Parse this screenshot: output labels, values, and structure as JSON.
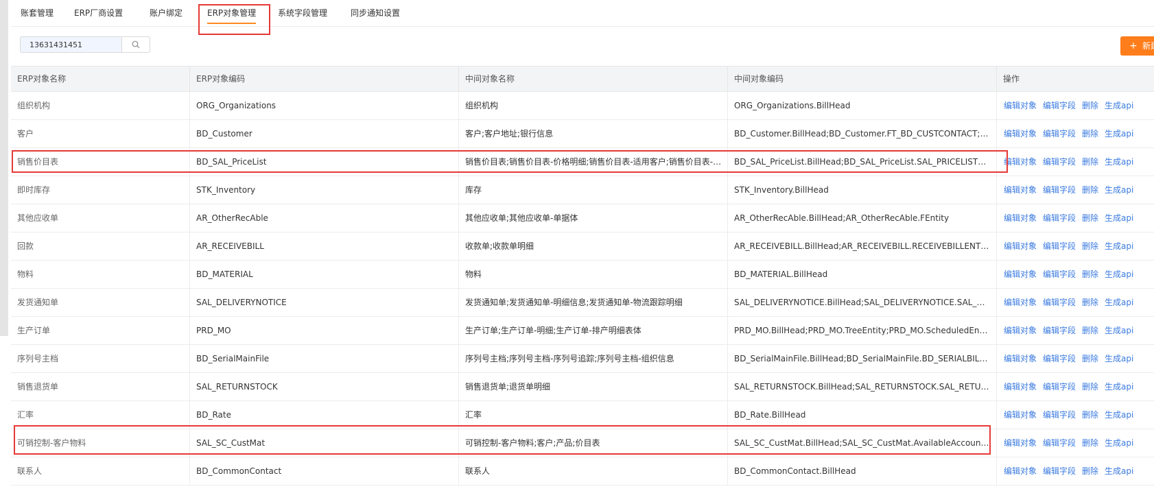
{
  "tabs": [
    {
      "label": "账套管理",
      "active": false
    },
    {
      "label": "ERP厂商设置",
      "active": false
    },
    {
      "label": "账户绑定",
      "active": false
    },
    {
      "label": "ERP对象管理",
      "active": true
    },
    {
      "label": "系统字段管理",
      "active": false
    },
    {
      "label": "同步通知设置",
      "active": false
    }
  ],
  "search": {
    "value": "13631431451",
    "placeholder": ""
  },
  "toolbar": {
    "add_label": "新建",
    "add_icon": "plus-icon"
  },
  "table": {
    "headers": [
      "ERP对象名称",
      "ERP对象编码",
      "中间对象名称",
      "中间对象编码",
      "操作"
    ],
    "actions": [
      "编辑对象",
      "编辑字段",
      "删除",
      "生成api"
    ],
    "rows": [
      [
        "组织机构",
        "ORG_Organizations",
        "组织机构",
        "ORG_Organizations.BillHead"
      ],
      [
        "客户",
        "BD_Customer",
        "客户;客户地址;银行信息",
        "BD_Customer.BillHead;BD_Customer.FT_BD_CUSTCONTACT;BD_Customer.FT_BD_CUSTBANK"
      ],
      [
        "销售价目表",
        "BD_SAL_PriceList",
        "销售价目表;销售价目表-价格明细;销售价目表-适用客户;销售价目表-适用销售员",
        "BD_SAL_PriceList.BillHead;BD_SAL_PriceList.SAL_PRICELISTENTRY;BD_SAL_PriceList.SAL_APPLYCUSTOMER"
      ],
      [
        "即时库存",
        "STK_Inventory",
        "库存",
        "STK_Inventory.BillHead"
      ],
      [
        "其他应收单",
        "AR_OtherRecAble",
        "其他应收单;其他应收单-单据体",
        "AR_OtherRecAble.BillHead;AR_OtherRecAble.FEntity"
      ],
      [
        "回款",
        "AR_RECEIVEBILL",
        "收款单;收款单明细",
        "AR_RECEIVEBILL.BillHead;AR_RECEIVEBILL.RECEIVEBILLENTRY"
      ],
      [
        "物料",
        "BD_MATERIAL",
        "物料",
        "BD_MATERIAL.BillHead"
      ],
      [
        "发货通知单",
        "SAL_DELIVERYNOTICE",
        "发货通知单;发货通知单-明细信息;发货通知单-物流跟踪明细",
        "SAL_DELIVERYNOTICE.BillHead;SAL_DELIVERYNOTICE.SAL_DELIVERYNOTICEENTRY"
      ],
      [
        "生产订单",
        "PRD_MO",
        "生产订单;生产订单-明细;生产订单-排产明细表体",
        "PRD_MO.BillHead;PRD_MO.TreeEntity;PRD_MO.ScheduledEntity"
      ],
      [
        "序列号主档",
        "BD_SerialMainFile",
        "序列号主档;序列号主档-序列号追踪;序列号主档-组织信息",
        "BD_SerialMainFile.BillHead;BD_SerialMainFile.BD_SERIALBILLTRACE;BD_SerialMainFile.BD_SERIALORG"
      ],
      [
        "销售退货单",
        "SAL_RETURNSTOCK",
        "销售退货单;退货单明细",
        "SAL_RETURNSTOCK.BillHead;SAL_RETURNSTOCK.SAL_RETURNSTOCKENTRY"
      ],
      [
        "汇率",
        "BD_Rate",
        "汇率",
        "BD_Rate.BillHead"
      ],
      [
        "可销控制-客户物料",
        "SAL_SC_CustMat",
        "可销控制-客户物料;客户;产品;价目表",
        "SAL_SC_CustMat.BillHead;SAL_SC_CustMat.AvailableAccountObj;SAL_SC_CustMat.Product"
      ],
      [
        "联系人",
        "BD_CommonContact",
        "联系人",
        "BD_CommonContact.BillHead"
      ]
    ]
  },
  "colors": {
    "accent": "#ff7d1a",
    "link": "#3a7ae0",
    "highlight": "#e53935"
  }
}
